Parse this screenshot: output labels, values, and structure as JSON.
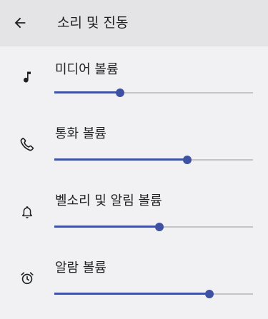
{
  "header": {
    "title": "소리 및 진동"
  },
  "volumes": [
    {
      "label": "미디어 볼륨",
      "icon": "music-note-icon",
      "value": 0.33
    },
    {
      "label": "통화 볼륨",
      "icon": "phone-icon",
      "value": 0.67
    },
    {
      "label": "벨소리 및 알림 볼륨",
      "icon": "bell-icon",
      "value": 0.53
    },
    {
      "label": "알람 볼륨",
      "icon": "alarm-clock-icon",
      "value": 0.78
    }
  ],
  "colors": {
    "accent": "#3f51a3",
    "track": "#c4c4c8",
    "background": "#f1f1f3",
    "toolbar": "#e4e4e6"
  }
}
